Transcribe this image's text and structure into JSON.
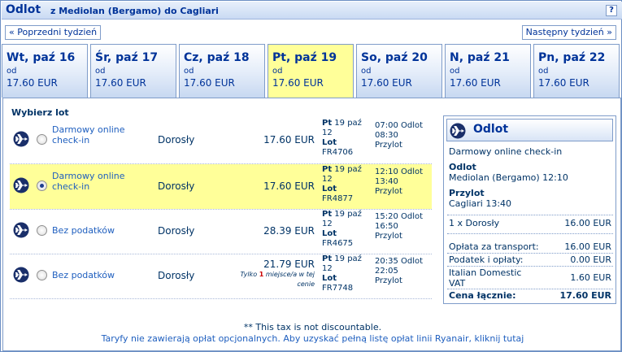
{
  "header": {
    "title": "Odlot",
    "route": "z Mediolan (Bergamo) do Cagliari",
    "help": "?"
  },
  "nav": {
    "prev": "« Poprzedni tydzień",
    "next": "Następny tydzień »"
  },
  "days": [
    {
      "day": "Wt, paź 16",
      "od": "od",
      "price": "17.60 EUR"
    },
    {
      "day": "Śr, paź 17",
      "od": "od",
      "price": "17.60 EUR"
    },
    {
      "day": "Cz, paź 18",
      "od": "od",
      "price": "17.60 EUR"
    },
    {
      "day": "Pt, paź 19",
      "od": "od",
      "price": "17.60 EUR"
    },
    {
      "day": "So, paź 20",
      "od": "od",
      "price": "17.60 EUR"
    },
    {
      "day": "N, paź 21",
      "od": "od",
      "price": "17.60 EUR"
    },
    {
      "day": "Pn, paź 22",
      "od": "od",
      "price": "17.60 EUR"
    }
  ],
  "selected_day": 3,
  "flights_heading": "Wybierz lot",
  "flights": [
    {
      "fare_line1": "Darmowy online",
      "fare_line2": "check-in",
      "pax": "Dorosły",
      "price": "17.60 EUR",
      "seats_pre": "",
      "seats_num": "",
      "seats_post": "",
      "date_day": "Pt",
      "date_rest": "19 paź",
      "date_line2": "12",
      "lot": "Lot",
      "flight_no": "FR4706",
      "dep": "07:00 Odlot",
      "arr_time": "08:30",
      "arr": "Przylot",
      "selected": false
    },
    {
      "fare_line1": "Darmowy online",
      "fare_line2": "check-in",
      "pax": "Dorosły",
      "price": "17.60 EUR",
      "seats_pre": "",
      "seats_num": "",
      "seats_post": "",
      "date_day": "Pt",
      "date_rest": "19 paź",
      "date_line2": "12",
      "lot": "Lot",
      "flight_no": "FR4877",
      "dep": "12:10 Odlot",
      "arr_time": "13:40",
      "arr": "Przylot",
      "selected": true
    },
    {
      "fare_line1": "Bez podatków",
      "fare_line2": "",
      "pax": "Dorosły",
      "price": "28.39 EUR",
      "seats_pre": "",
      "seats_num": "",
      "seats_post": "",
      "date_day": "Pt",
      "date_rest": "19 paź",
      "date_line2": "12",
      "lot": "Lot",
      "flight_no": "FR4675",
      "dep": "15:20 Odlot",
      "arr_time": "16:50",
      "arr": "Przylot",
      "selected": false
    },
    {
      "fare_line1": "Bez podatków",
      "fare_line2": "",
      "pax": "Dorosły",
      "price": "21.79 EUR",
      "seats_pre": "Tylko",
      "seats_num": "1",
      "seats_post": "miejsce/a w tej",
      "seats_line2": "cenie",
      "date_day": "Pt",
      "date_rest": "19 paź",
      "date_line2": "12",
      "lot": "Lot",
      "flight_no": "FR7748",
      "dep": "20:35 Odlot",
      "arr_time": "22:05",
      "arr": "Przylot",
      "selected": false
    }
  ],
  "summary": {
    "title": "Odlot",
    "fare": "Darmowy online check-in",
    "dep_label": "Odlot",
    "dep_value": "Mediolan (Bergamo) 12:10",
    "arr_label": "Przylot",
    "arr_value": "Cagliari 13:40",
    "pax_line": "1 x Dorosły",
    "pax_price": "16.00 EUR",
    "transport_label": "Opłata za transport:",
    "transport_value": "16.00 EUR",
    "taxes_label": "Podatek i opłaty:",
    "taxes_value": "0.00 EUR",
    "vat_label1": "Italian Domestic",
    "vat_label2": "VAT",
    "vat_value": "1.60 EUR",
    "total_label": "Cena łącznie:",
    "total_value": "17.60 EUR"
  },
  "notes": {
    "tax": "** This tax is not discountable.",
    "link": "Taryfy nie zawierają opłat opcjonalnych. Aby uzyskać pełną listę opłat linii Ryanair, kliknij tutaj"
  },
  "colors": {
    "accent": "#003399",
    "selected_bg": "#ffff99",
    "link": "#1f5fbf",
    "border": "#7f9cc9"
  }
}
